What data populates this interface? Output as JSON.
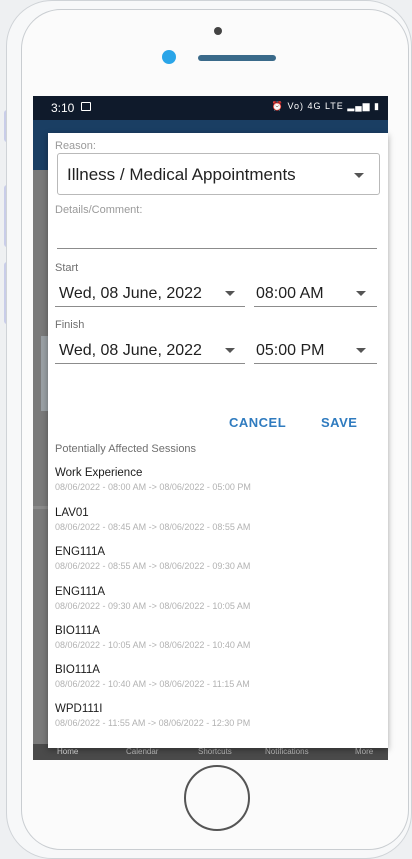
{
  "status_bar": {
    "time": "3:10",
    "network_text": "Vo) 4G LTE"
  },
  "bottom_nav": {
    "items": [
      "Home",
      "Calendar",
      "Shortcuts",
      "Notifications",
      "More"
    ]
  },
  "dialog": {
    "reason_label": "Reason:",
    "reason_value": "Illness / Medical Appointments",
    "details_label": "Details/Comment:",
    "details_value": "",
    "start_label": "Start",
    "start_date": "Wed, 08 June, 2022",
    "start_time": "08:00 AM",
    "finish_label": "Finish",
    "finish_date": "Wed, 08 June, 2022",
    "finish_time": "05:00 PM",
    "cancel_label": "CANCEL",
    "save_label": "SAVE",
    "sessions_header": "Potentially Affected Sessions",
    "sessions": [
      {
        "title": "Work Experience",
        "time": "08/06/2022 - 08:00 AM -> 08/06/2022 - 05:00 PM"
      },
      {
        "title": "LAV01",
        "time": "08/06/2022 - 08:45 AM -> 08/06/2022 - 08:55 AM"
      },
      {
        "title": "ENG111A",
        "time": "08/06/2022 - 08:55 AM -> 08/06/2022 - 09:30 AM"
      },
      {
        "title": "ENG111A",
        "time": "08/06/2022 - 09:30 AM -> 08/06/2022 - 10:05 AM"
      },
      {
        "title": "BIO111A",
        "time": "08/06/2022 - 10:05 AM -> 08/06/2022 - 10:40 AM"
      },
      {
        "title": "BIO111A",
        "time": "08/06/2022 - 10:40 AM -> 08/06/2022 - 11:15 AM"
      },
      {
        "title": "WPD111I",
        "time": "08/06/2022 - 11:55 AM -> 08/06/2022 - 12:30 PM"
      }
    ]
  }
}
